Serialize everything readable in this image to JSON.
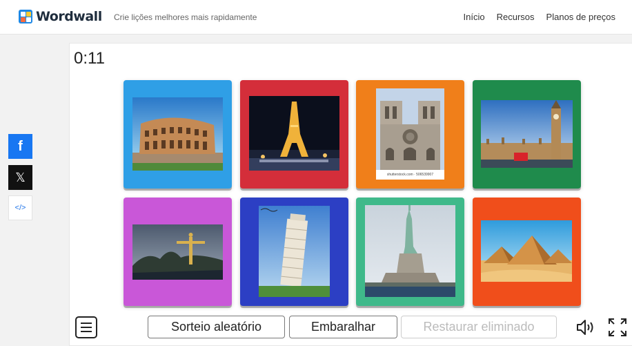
{
  "header": {
    "logo_text": "Wordwall",
    "tagline": "Crie lições melhores mais rapidamente",
    "nav": [
      "Início",
      "Recursos",
      "Planos de preços"
    ]
  },
  "social": {
    "facebook_glyph": "f",
    "x_glyph": "𝕏",
    "embed_glyph": "</>"
  },
  "game": {
    "timer": "0:11",
    "cards": [
      {
        "name": "colosseum",
        "color": "#2f9fe6"
      },
      {
        "name": "eiffel-tower",
        "color": "#d42e3a"
      },
      {
        "name": "notre-dame",
        "color": "#f07f1a"
      },
      {
        "name": "big-ben",
        "color": "#1f8b4c"
      },
      {
        "name": "christ-the-redeemer",
        "color": "#c957d8"
      },
      {
        "name": "leaning-tower-of-pisa",
        "color": "#2c3fc4"
      },
      {
        "name": "statue-of-liberty",
        "color": "#3fb98a"
      },
      {
        "name": "pyramids-of-giza",
        "color": "#f04e1b"
      }
    ],
    "notre_dame_caption": "shutterstock.com · 506539907"
  },
  "toolbar": {
    "random_label": "Sorteio aleatório",
    "shuffle_label": "Embaralhar",
    "restore_label": "Restaurar eliminado",
    "menu_icon": "hamburger-icon",
    "sound_icon": "speaker-icon",
    "fullscreen_icon": "fullscreen-icon"
  }
}
